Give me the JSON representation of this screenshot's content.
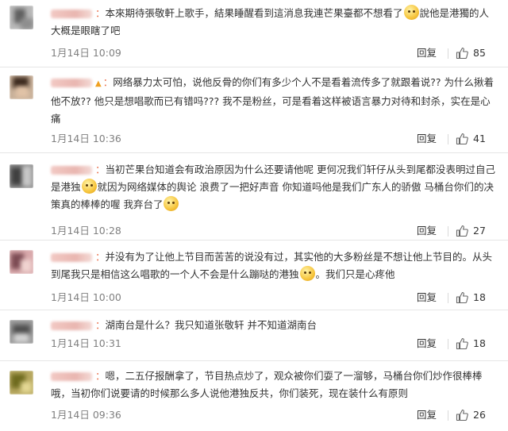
{
  "comments": [
    {
      "segments": [
        {
          "text": "本來期待張敬軒上歌手，結果睡醒看到這消息我連芒果臺都不想看了"
        },
        {
          "emoji": "smile"
        },
        {
          "text": "說他是港獨的人大概是眼瞎了吧"
        }
      ],
      "time": "1月14日 10:09",
      "reply": "回复",
      "likes": "85",
      "avatar": "a1"
    },
    {
      "segments": [
        {
          "text": "网络暴力太可怕，说他反骨的你们有多少个人不是看着流传多了就跟着说?? 为什么揪着他不放?? 他只是想唱歌而已有错吗??? 我不是粉丝，可是看着这样被语言暴力对待和封杀，实在是心痛"
        }
      ],
      "time": "1月14日 10:36",
      "reply": "回复",
      "likes": "41",
      "avatar": "a2",
      "vip": true
    },
    {
      "segments": [
        {
          "text": "当初芒果台知道会有政治原因为什么还要请他呢 更何况我们轩仔从头到尾都没表明过自己是港独"
        },
        {
          "emoji": "sweat"
        },
        {
          "text": "就因为网络媒体的舆论 浪费了一把好声音 你知道吗他是我们广东人的骄傲 马桶台你们的决策真的棒棒的喔 我弃台了"
        },
        {
          "emoji": "angry"
        }
      ],
      "time": "1月14日 10:28",
      "reply": "回复",
      "likes": "27",
      "avatar": "a3"
    },
    {
      "segments": [
        {
          "text": "并没有为了让他上节目而苦苦的说没有过，其实他的大多粉丝是不想让他上节目的。从头到尾我只是相信这么唱歌的一个人不会是什么蹦哒的港独"
        },
        {
          "emoji": "sigh"
        },
        {
          "text": "。我们只是心疼他"
        }
      ],
      "time": "1月14日 10:00",
      "reply": "回复",
      "likes": "18",
      "avatar": "a4"
    },
    {
      "segments": [
        {
          "text": "湖南台是什么？我只知道张敬轩 并不知道湖南台"
        }
      ],
      "time": "1月14日 10:31",
      "reply": "回复",
      "likes": "18",
      "avatar": "a5"
    },
    {
      "segments": [
        {
          "text": "嗯，二五仔报酬拿了，节目热点炒了，观众被你们耍了一溜够，马桶台你们炒作很棒棒哦，当初你们说要请的时候那么多人说他港独反共，你们装死，现在装什么有原则"
        }
      ],
      "time": "1月14日 09:36",
      "reply": "回复",
      "likes": "26",
      "avatar": "a6"
    }
  ],
  "icons": {
    "like": "thumbs-up-icon"
  },
  "colors": {
    "username": "#eb7350",
    "meta": "#808080",
    "text": "#333333"
  }
}
